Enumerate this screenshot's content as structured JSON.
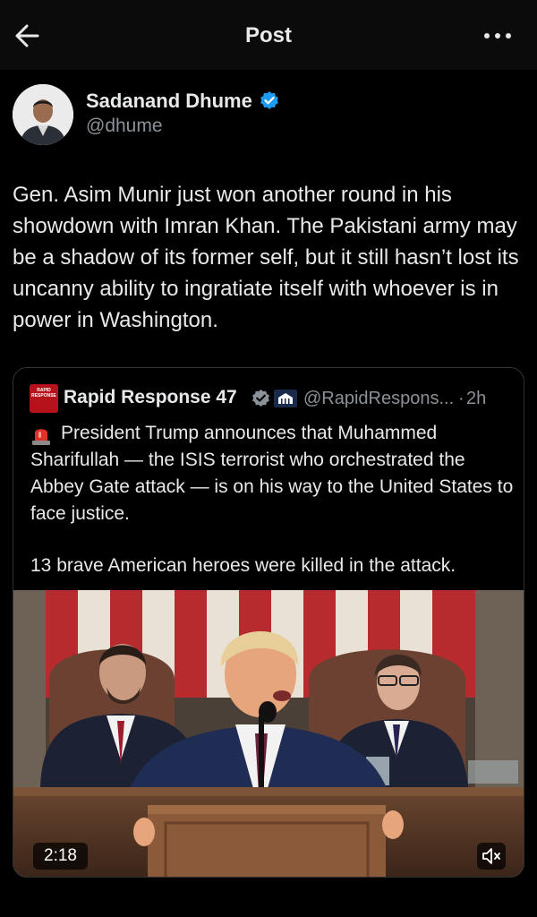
{
  "header": {
    "title": "Post"
  },
  "author": {
    "name": "Sadanand Dhume",
    "handle": "@dhume"
  },
  "post": {
    "text": "Gen. Asim Munir just won another round in his showdown with Imran Khan. The Pakistani army may be a shadow of its former self, but it still hasn’t lost its uncanny ability to ingratiate itself with whoever is in power in Washington."
  },
  "quote": {
    "logo_text": "RAPID RESPONSE",
    "name": "Rapid Response 47",
    "handle": "@RapidRespons...",
    "separator": "·",
    "time": "2h",
    "text": "President Trump announces that Muhammed Sharifullah — the ISIS terrorist who orchestrated the Abbey Gate attack — is on his way to the United States to face justice.",
    "text2": "13 brave American heroes were killed in the attack.",
    "video": {
      "duration": "2:18"
    }
  },
  "colors": {
    "background": "#000000",
    "text": "#e7e9ea",
    "secondary_text": "#8b9198",
    "verified_blue": "#1d9bf0",
    "border": "#2f3336"
  },
  "icons": {
    "back": "arrow-left-icon",
    "more": "more-horizontal-icon",
    "verified": "verified-badge-icon",
    "government": "white-house-icon",
    "siren": "rotating-light-icon",
    "mute": "volume-muted-icon"
  }
}
